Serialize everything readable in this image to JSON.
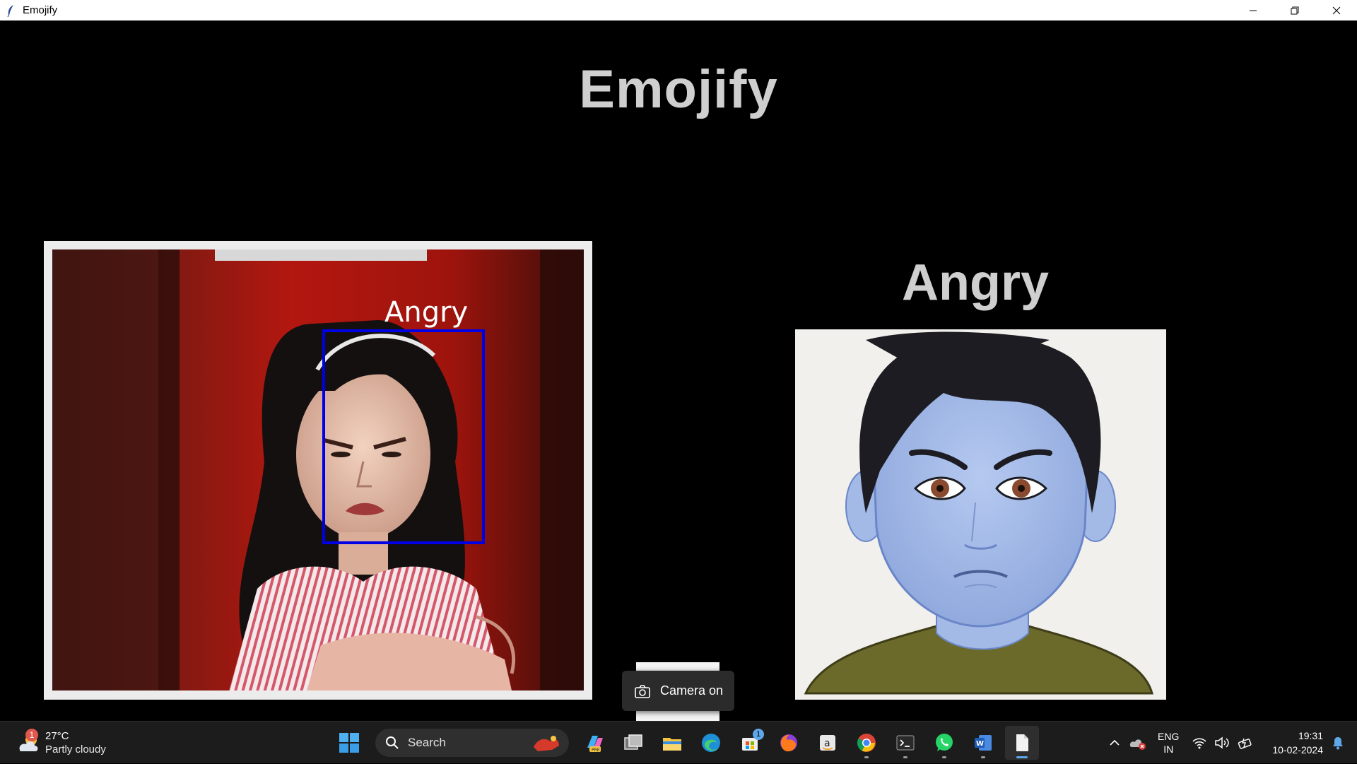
{
  "window": {
    "title": "Emojify"
  },
  "app": {
    "heading": "Emojify",
    "detected_emotion": "Angry",
    "face_box_label": "Angry",
    "camera_tooltip": "Camera on"
  },
  "taskbar": {
    "weather": {
      "temperature": "27°C",
      "condition": "Partly cloudy",
      "badge": "1"
    },
    "search_placeholder": "Search",
    "store_badge": "1",
    "apps": [
      "copilot-icon",
      "task-view-icon",
      "file-explorer-icon",
      "edge-icon",
      "store-icon",
      "firefox-icon",
      "amazon-icon",
      "chrome-icon",
      "terminal-icon",
      "whatsapp-icon",
      "word-icon",
      "file-icon"
    ],
    "language": {
      "line1": "ENG",
      "line2": "IN"
    },
    "clock": {
      "time": "19:31",
      "date": "10-02-2024"
    }
  },
  "colors": {
    "face_box": "#0000e6",
    "title_text": "#cfcfcf",
    "avatar_skin": "#a9bfe9",
    "avatar_shirt": "#6b6a2a"
  }
}
